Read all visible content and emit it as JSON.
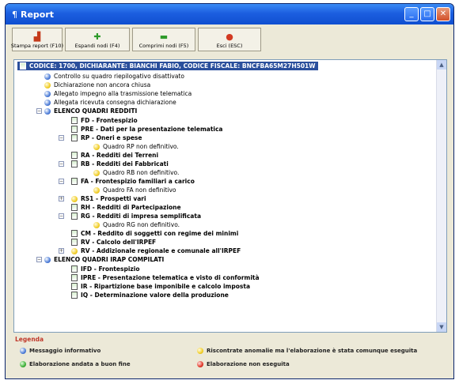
{
  "window": {
    "title": "Report",
    "minimize": "_",
    "maximize": "□",
    "close": "✕"
  },
  "toolbar": [
    {
      "label": "Stampa report (F10)",
      "icon": "print-icon"
    },
    {
      "label": "Espandi nodi (F4)",
      "icon": "expand-icon"
    },
    {
      "label": "Comprimi nodi (F5)",
      "icon": "collapse-icon"
    },
    {
      "label": "Esci (ESC)",
      "icon": "exit-icon"
    }
  ],
  "tree": {
    "header": "CODICE: 1700, DICHIARANTE: BIANCHI FABIO, CODICE FISCALE: BNCFBA65M27H501W",
    "messages": [
      "Controllo su quadro riepilogativo disattivato",
      "Dichiarazione non ancora chiusa",
      "Allegato impegno alla trasmissione telematica",
      "Allegata ricevuta consegna dichiarazione"
    ],
    "section1": "ELENCO QUADRI REDDITI",
    "items1": [
      "FD - Frontespizio",
      "PRE - Dati per la presentazione telematica",
      "RP - Oneri e spese",
      "Quadro RP non definitivo.",
      "RA - Redditi dei Terreni",
      "RB - Redditi dei Fabbricati",
      "Quadro RB non definitivo.",
      "FA - Frontespizio familiari a carico",
      "Quadro FA non definitivo",
      "RS1 - Prospetti vari",
      "RH - Redditi di Partecipazione",
      "RG - Redditi di impresa semplificata",
      "Quadro RG non definitivo.",
      "CM - Reddito di soggetti con regime dei minimi",
      "RV - Calcolo dell'IRPEF",
      "RV - Addizionale regionale e comunale all'IRPEF"
    ],
    "section2": "ELENCO QUADRI IRAP COMPILATI",
    "items2": [
      "IFD - Frontespizio",
      "IPRE - Presentazione telematica e visto di conformità",
      "IR - Ripartizione base imponibile e calcolo imposta",
      "IQ - Determinazione valore della produzione"
    ]
  },
  "legend": {
    "title": "Legenda",
    "info": "Messaggio informativo",
    "warning": "Riscontrate anomalie ma l'elaborazione è stata comunque eseguita",
    "ok": "Elaborazione andata a buon fine",
    "error": "Elaborazione non eseguita"
  }
}
